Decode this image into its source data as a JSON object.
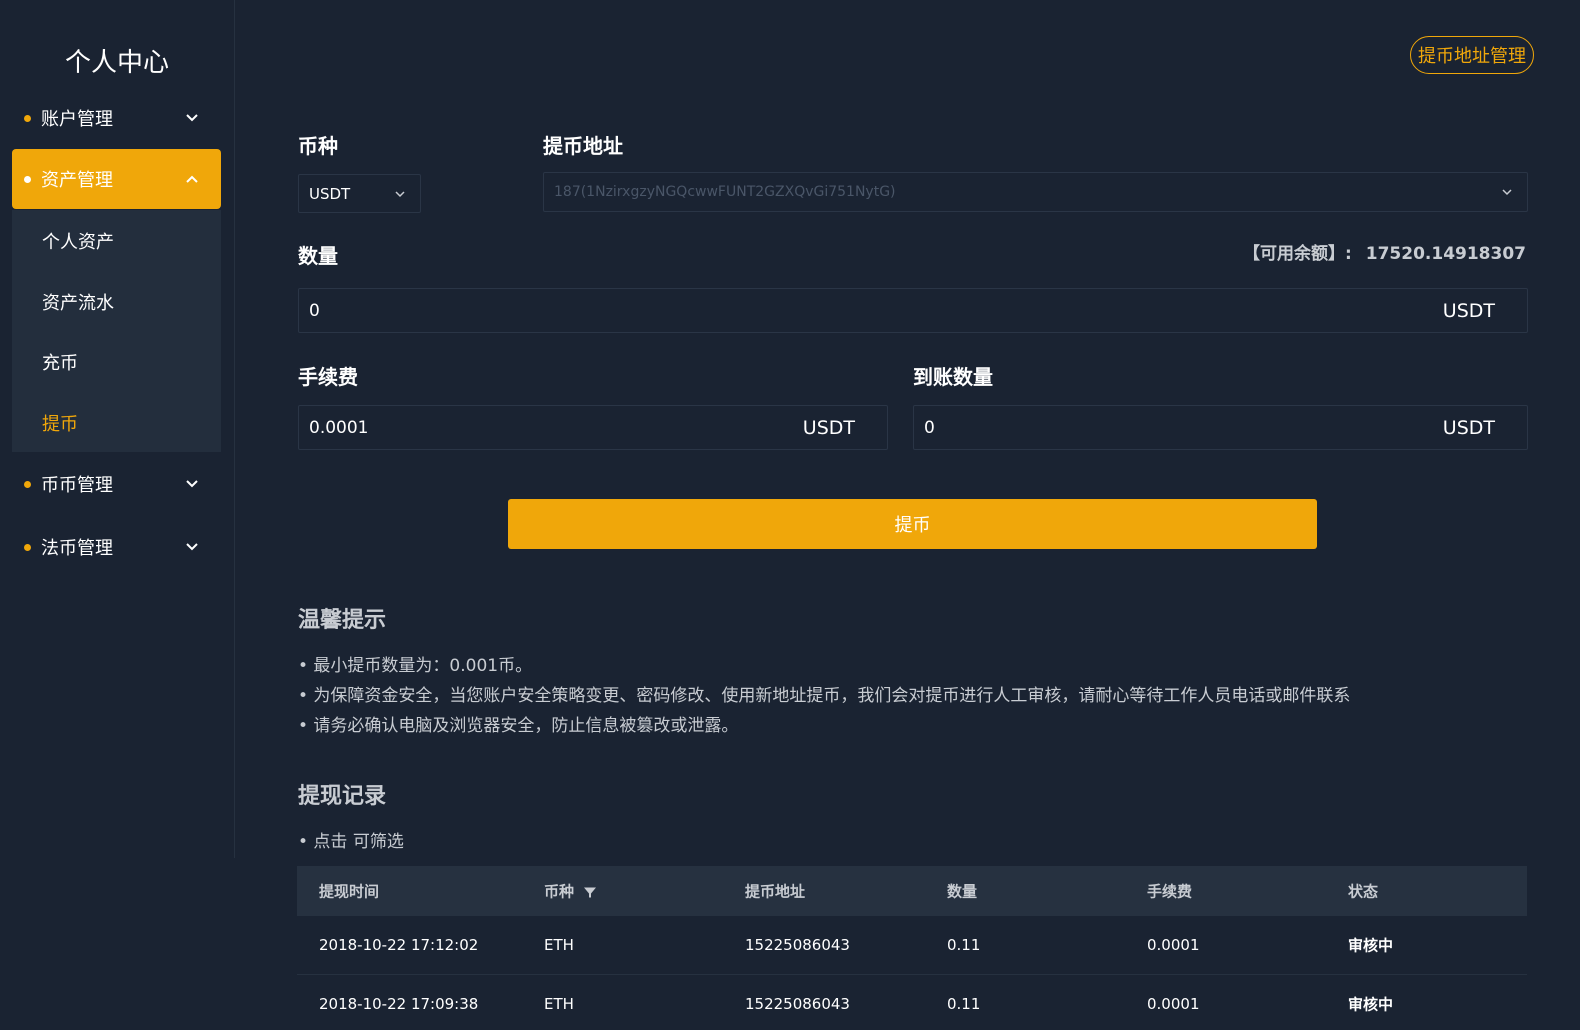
{
  "sidebar": {
    "title": "个人中心",
    "menu": [
      {
        "label": "账户管理"
      },
      {
        "label": "资产管理"
      },
      {
        "label": "币币管理"
      },
      {
        "label": "法币管理"
      }
    ],
    "submenu": [
      {
        "label": "个人资产"
      },
      {
        "label": "资产流水"
      },
      {
        "label": "充币"
      },
      {
        "label": "提币"
      }
    ]
  },
  "header": {
    "address_mgmt_button": "提币地址管理"
  },
  "form": {
    "currency_label": "币种",
    "currency_value": "USDT",
    "address_label": "提币地址",
    "address_value": "187(1NzirxgzyNGQcwwFUNT2GZXQvGi751NytG)",
    "amount_label": "数量",
    "balance_label": "【可用余额】:",
    "balance_value": "17520.14918307",
    "amount_value": "0",
    "amount_unit": "USDT",
    "fee_label": "手续费",
    "fee_value": "0.0001",
    "fee_unit": "USDT",
    "received_label": "到账数量",
    "received_value": "0",
    "received_unit": "USDT",
    "submit_label": "提币"
  },
  "tips": {
    "title": "温馨提示",
    "items": [
      "• 最小提币数量为：0.001币。",
      "• 为保障资金安全，当您账户安全策略变更、密码修改、使用新地址提币，我们会对提币进行人工审核，请耐心等待工作人员电话或邮件联系",
      "• 请务必确认电脑及浏览器安全，防止信息被篡改或泄露。"
    ]
  },
  "records": {
    "title": "提现记录",
    "hint": "• 点击 可筛选",
    "columns": [
      "提现时间",
      "币种",
      "提币地址",
      "数量",
      "手续费",
      "状态"
    ],
    "rows": [
      [
        "2018-10-22 17:12:02",
        "ETH",
        "15225086043",
        "0.11",
        "0.0001",
        "审核中"
      ],
      [
        "2018-10-22 17:09:38",
        "ETH",
        "15225086043",
        "0.11",
        "0.0001",
        "审核中"
      ]
    ]
  },
  "colors": {
    "background": "#1a2332",
    "accent": "#f0a70a",
    "panel": "#232e3d",
    "table_header": "#263140"
  }
}
